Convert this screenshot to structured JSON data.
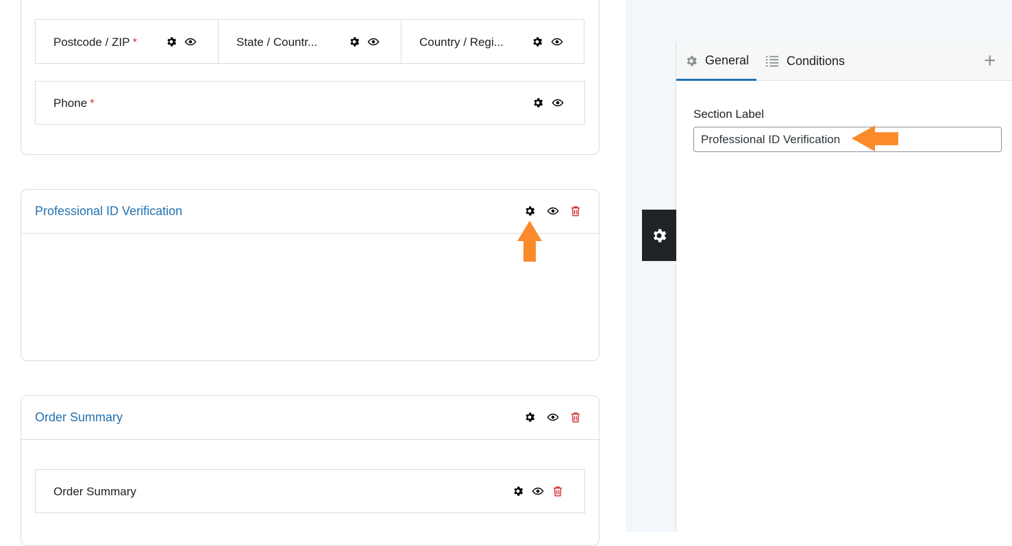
{
  "fields_row": [
    {
      "label": "Postcode / ZIP",
      "required": true
    },
    {
      "label": "State / Countr...",
      "required": false
    },
    {
      "label": "Country / Regi...",
      "required": false
    }
  ],
  "phone": {
    "label": "Phone",
    "required": true
  },
  "required_mark": "*",
  "sections": {
    "professional": {
      "title": "Professional ID Verification"
    },
    "order": {
      "title": "Order Summary",
      "field_label": "Order Summary"
    }
  },
  "panel": {
    "tabs": {
      "general": "General",
      "conditions": "Conditions"
    },
    "add_symbol": "+",
    "section_label_title": "Section Label",
    "section_label_value": "Professional ID Verification"
  },
  "colors": {
    "accent": "#2271b1",
    "danger": "#d63638",
    "annotation_arrow": "#fb8a2b"
  },
  "icons": [
    "gear-icon",
    "eye-icon",
    "trash-icon",
    "list-icon",
    "plus-icon",
    "annotation-arrow"
  ]
}
